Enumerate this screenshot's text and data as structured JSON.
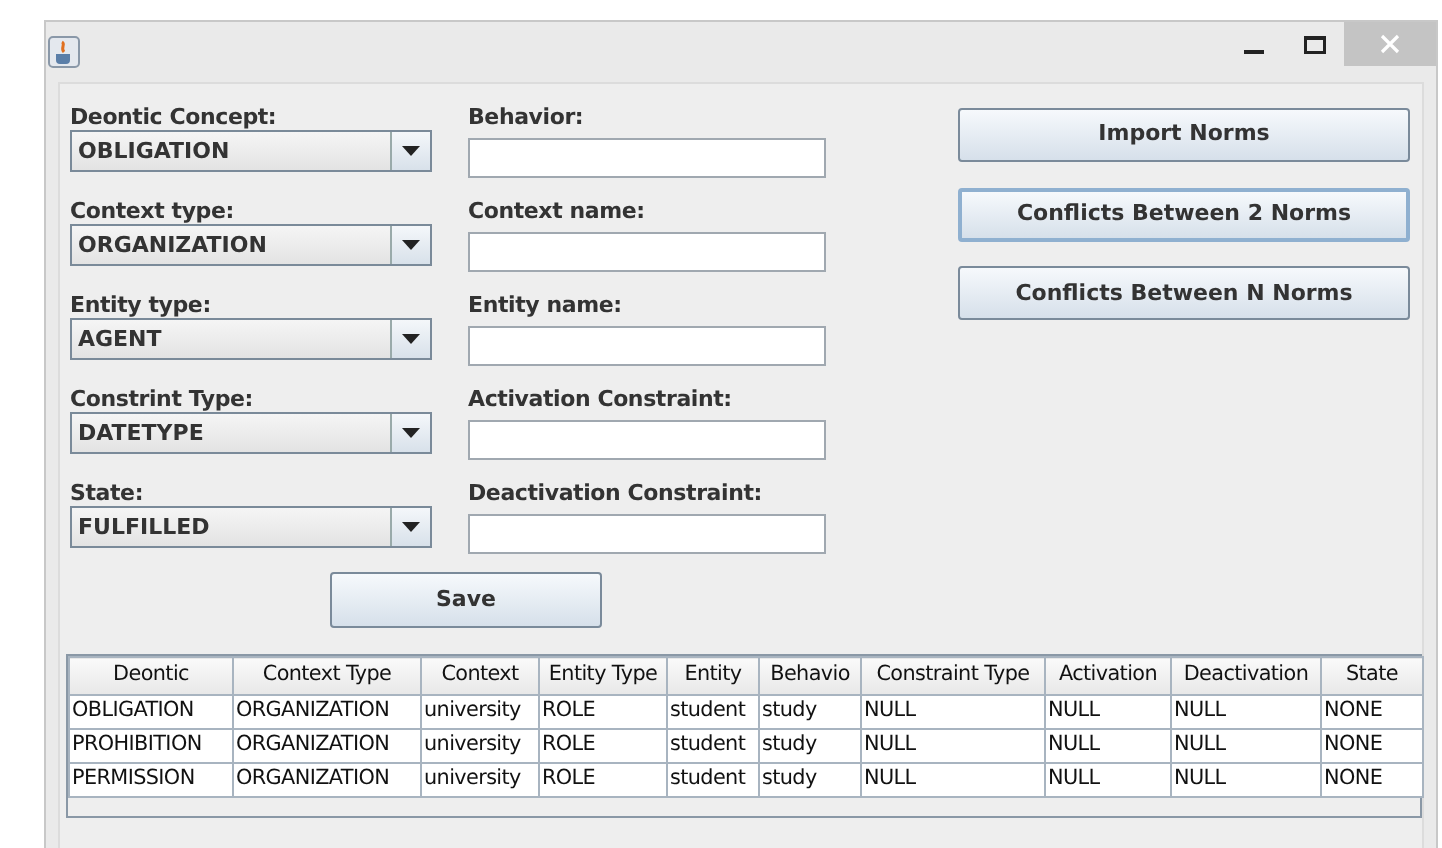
{
  "combos": [
    {
      "label": "Deontic Concept:",
      "value": "OBLIGATION"
    },
    {
      "label": "Context type:",
      "value": "ORGANIZATION"
    },
    {
      "label": "Entity type:",
      "value": "AGENT"
    },
    {
      "label": "Constrint Type:",
      "value": "DATETYPE"
    },
    {
      "label": "State:",
      "value": "FULFILLED"
    }
  ],
  "text_fields": [
    {
      "label": "Behavior:"
    },
    {
      "label": "Context name:"
    },
    {
      "label": "Entity name:"
    },
    {
      "label": "Activation Constraint:"
    },
    {
      "label": "Deactivation Constraint:"
    }
  ],
  "buttons": [
    {
      "label": "Import Norms",
      "focused": false
    },
    {
      "label": "Conflicts Between 2 Norms",
      "focused": true
    },
    {
      "label": "Conflicts Between N Norms",
      "focused": false
    }
  ],
  "save_button": "Save",
  "table": {
    "columns": [
      "Deontic",
      "Context Type",
      "Context",
      "Entity Type",
      "Entity",
      "Behavio",
      "Constraint Type",
      "Activation",
      "Deactivation",
      "State"
    ],
    "rows": [
      [
        "OBLIGATION",
        "ORGANIZATION",
        "university",
        "ROLE",
        "student",
        "study",
        "NULL",
        "NULL",
        "NULL",
        "NONE"
      ],
      [
        "PROHIBITION",
        "ORGANIZATION",
        "university",
        "ROLE",
        "student",
        "study",
        "NULL",
        "NULL",
        "NULL",
        "NONE"
      ],
      [
        "PERMISSION",
        "ORGANIZATION",
        "university",
        "ROLE",
        "student",
        "study",
        "NULL",
        "NULL",
        "NULL",
        "NONE"
      ]
    ]
  }
}
